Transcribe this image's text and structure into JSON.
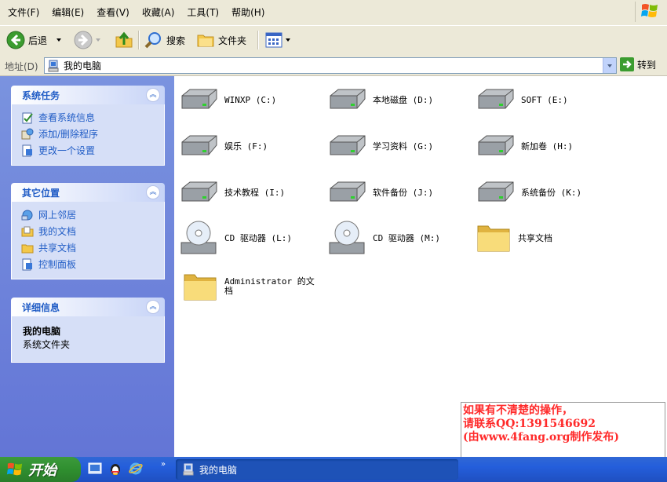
{
  "menu": {
    "items": [
      "文件(F)",
      "编辑(E)",
      "查看(V)",
      "收藏(A)",
      "工具(T)",
      "帮助(H)"
    ]
  },
  "toolbar": {
    "back_label": "后退",
    "search_label": "搜索",
    "folders_label": "文件夹"
  },
  "address": {
    "label": "地址(D)",
    "value": "我的电脑",
    "go_label": "转到"
  },
  "left_panes": {
    "system_tasks": {
      "title": "系统任务",
      "links": [
        "查看系统信息",
        "添加/删除程序",
        "更改一个设置"
      ]
    },
    "other_places": {
      "title": "其它位置",
      "links": [
        "网上邻居",
        "我的文档",
        "共享文档",
        "控制面板"
      ]
    },
    "details": {
      "title": "详细信息",
      "name": "我的电脑",
      "type": "系统文件夹"
    }
  },
  "items": [
    {
      "label": "WINXP (C:)",
      "icon": "hard-drive"
    },
    {
      "label": "本地磁盘 (D:)",
      "icon": "hard-drive"
    },
    {
      "label": "SOFT (E:)",
      "icon": "hard-drive"
    },
    {
      "label": "娱乐 (F:)",
      "icon": "hard-drive"
    },
    {
      "label": "学习资料 (G:)",
      "icon": "hard-drive"
    },
    {
      "label": "新加卷 (H:)",
      "icon": "hard-drive"
    },
    {
      "label": "技术教程 (I:)",
      "icon": "hard-drive"
    },
    {
      "label": "软件备份 (J:)",
      "icon": "hard-drive"
    },
    {
      "label": "系统备份 (K:)",
      "icon": "hard-drive"
    },
    {
      "label": "CD 驱动器 (L:)",
      "icon": "cd-drive"
    },
    {
      "label": "CD 驱动器 (M:)",
      "icon": "cd-drive"
    },
    {
      "label": "共享文档",
      "icon": "folder"
    },
    {
      "label": "Administrator 的文档",
      "icon": "folder"
    }
  ],
  "note": {
    "line1": "如果有不清楚的操作，",
    "line2": "请联系QQ:1391546692",
    "line3": "(由www.4fang.org制作发布)"
  },
  "taskbar": {
    "start_label": "开始",
    "task_label": "我的电脑"
  }
}
